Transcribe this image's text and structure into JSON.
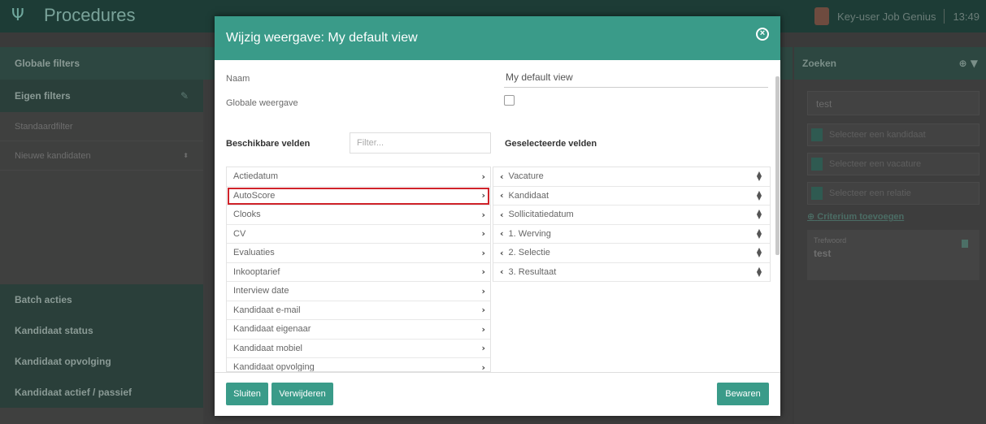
{
  "app": {
    "title": "Procedures",
    "user": "Key-user Job Genius",
    "time": "13:49"
  },
  "left_panel": {
    "globale_filters": "Globale filters",
    "eigen_filters": "Eigen filters",
    "items": [
      "Standaardfilter",
      "Nieuwe kandidaten"
    ],
    "bottom": [
      "Batch acties",
      "Kandidaat status",
      "Kandidaat opvolging",
      "Kandidaat actief / passief"
    ]
  },
  "right_panel": {
    "header": "Zoeken",
    "search_value": "test",
    "selects": [
      "Selecteer een kandidaat",
      "Selecteer een vacature",
      "Selecteer een relatie"
    ],
    "criterium_link": "Criterium toevoegen",
    "card_key": "Trefwoord",
    "card_value": "test"
  },
  "modal": {
    "title": "Wijzig weergave: My default view",
    "naam_label": "Naam",
    "naam_value": "My default view",
    "globale_label": "Globale weergave",
    "beschikbare_title": "Beschikbare velden",
    "filter_placeholder": "Filter...",
    "geselecteerde_title": "Geselecteerde velden",
    "available_fields": [
      "Actiedatum",
      "AutoScore",
      "Clooks",
      "CV",
      "Evaluaties",
      "Inkooptarief",
      "Interview date",
      "Kandidaat e-mail",
      "Kandidaat eigenaar",
      "Kandidaat mobiel",
      "Kandidaat opvolging"
    ],
    "selected_fields": [
      "Vacature",
      "Kandidaat",
      "Sollicitatiedatum",
      "1. Werving",
      "2. Selectie",
      "3. Resultaat"
    ],
    "buttons": {
      "sluiten": "Sluiten",
      "verwijderen": "Verwijderen",
      "bewaren": "Bewaren"
    }
  }
}
